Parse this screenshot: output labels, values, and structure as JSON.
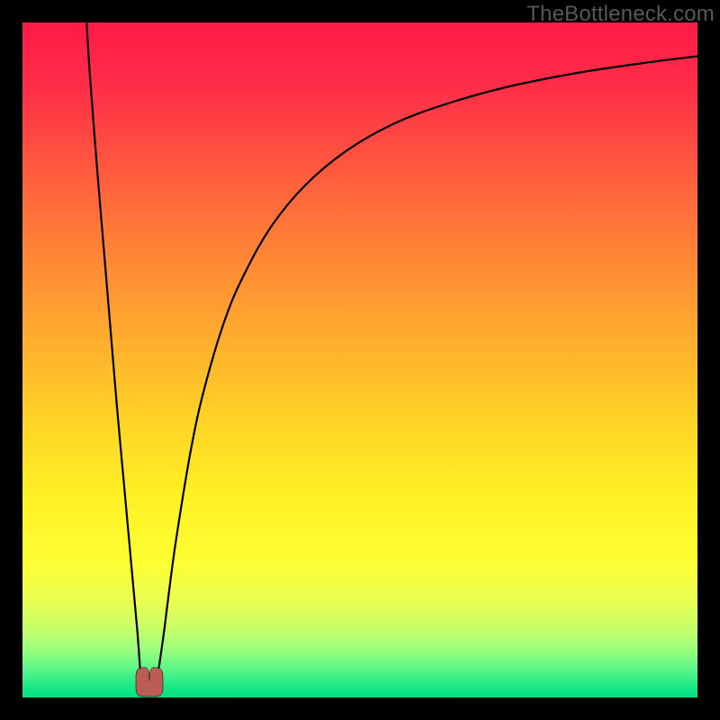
{
  "watermark_text": "TheBottleneck.com",
  "chart_data": {
    "type": "line",
    "title": "",
    "xlabel": "",
    "ylabel": "",
    "xlim": [
      0,
      100
    ],
    "ylim": [
      0,
      100
    ],
    "grid": false,
    "annotations": [],
    "series": [
      {
        "name": "curve-a-descending",
        "x": [
          9.5,
          10,
          11,
          12,
          13,
          14,
          15,
          16,
          17,
          17.5
        ],
        "values": [
          100,
          92,
          79,
          67,
          55,
          43,
          32,
          21,
          10,
          3
        ]
      },
      {
        "name": "curve-b-ascending",
        "x": [
          20,
          21,
          22,
          23,
          25,
          27,
          30,
          33,
          37,
          42,
          48,
          55,
          63,
          72,
          82,
          92,
          100
        ],
        "values": [
          3,
          10,
          18,
          25,
          37,
          46,
          56,
          63,
          70,
          76,
          81,
          85,
          88,
          90.5,
          92.5,
          94,
          95
        ]
      },
      {
        "name": "curve-bottom-cap",
        "x": [
          17.2,
          17.7,
          18.2,
          18.8,
          19.3,
          19.9,
          20.4
        ],
        "values": [
          3.4,
          2.3,
          1.8,
          1.6,
          1.8,
          2.3,
          3.4
        ]
      }
    ],
    "gradient_stops": [
      {
        "offset": 0.0,
        "color": "#ff1a47"
      },
      {
        "offset": 0.1,
        "color": "#ff2f48"
      },
      {
        "offset": 0.22,
        "color": "#ff5a3e"
      },
      {
        "offset": 0.34,
        "color": "#ff8436"
      },
      {
        "offset": 0.46,
        "color": "#ffaa2f"
      },
      {
        "offset": 0.58,
        "color": "#ffd027"
      },
      {
        "offset": 0.7,
        "color": "#fff024"
      },
      {
        "offset": 0.8,
        "color": "#fdff32"
      },
      {
        "offset": 0.86,
        "color": "#e8ff54"
      },
      {
        "offset": 0.9,
        "color": "#c4ff6a"
      },
      {
        "offset": 0.93,
        "color": "#99ff7d"
      },
      {
        "offset": 0.96,
        "color": "#56f58a"
      },
      {
        "offset": 0.985,
        "color": "#17e887"
      },
      {
        "offset": 1.0,
        "color": "#05df82"
      }
    ],
    "marker": {
      "color": "#bb5d55",
      "stroke": "#000000",
      "stroke_width": 0.5,
      "width_pct": 4.0,
      "height_pct": 4.3
    },
    "curve_style": {
      "stroke": "#000000",
      "stroke_width": 2.2
    }
  }
}
